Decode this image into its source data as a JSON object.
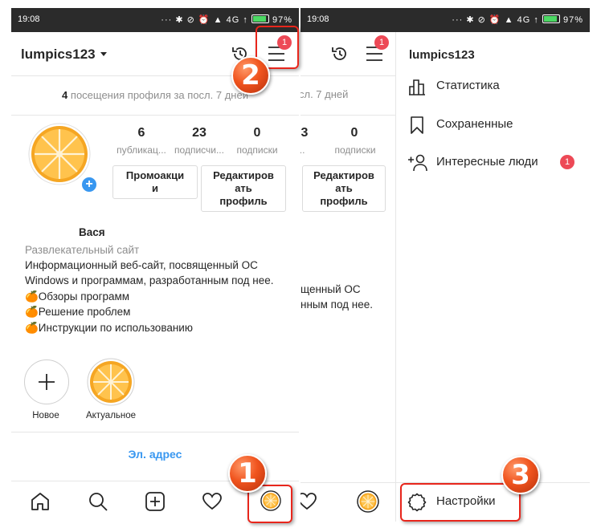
{
  "status": {
    "time": "19:08",
    "network": "4G",
    "battery": "97%"
  },
  "profile": {
    "username": "lumpics123",
    "menu_badge": "1",
    "visits_count": "4",
    "visits_text": "посещения профиля за посл. 7 дней",
    "visits_text_clipped": "сл. 7 дней",
    "stats": [
      {
        "num": "6",
        "label": "публикац..."
      },
      {
        "num": "23",
        "label": "подписчи..."
      },
      {
        "num": "0",
        "label": "подписки"
      }
    ],
    "stats_clipped": [
      {
        "num": "3",
        "label": "чи..."
      },
      {
        "num": "0",
        "label": "подписки"
      }
    ],
    "btn_promo": [
      "Промоакци",
      "и"
    ],
    "btn_edit": [
      "Редактиров",
      "ать",
      "профиль"
    ],
    "name": "Вася",
    "category": "Развлекательный сайт",
    "bio": [
      "Информационный веб-сайт, посвященный ОС",
      "Windows и программам, разработанным под нее.",
      "🍊Обзоры программ",
      "🍊Решение проблем",
      "🍊Инструкции по использованию"
    ],
    "bio_clipped": [
      "щенный ОС",
      "нным под нее."
    ],
    "highlights": [
      {
        "label": "Новое"
      },
      {
        "label": "Актуальное"
      }
    ],
    "email_link": "Эл. адрес"
  },
  "drawer": {
    "username": "lumpics123",
    "items": [
      {
        "label": "Статистика",
        "icon": "bar-chart-icon"
      },
      {
        "label": "Сохраненные",
        "icon": "bookmark-icon"
      },
      {
        "label": "Интересные люди",
        "icon": "add-person-icon",
        "badge": "1"
      }
    ],
    "settings": "Настройки"
  },
  "steps": [
    "1",
    "2",
    "3"
  ],
  "colors": {
    "accent_link": "#3897f0",
    "badge_red": "#ed4956",
    "callout_red": "#e8261c",
    "orange": "#f5a623"
  }
}
